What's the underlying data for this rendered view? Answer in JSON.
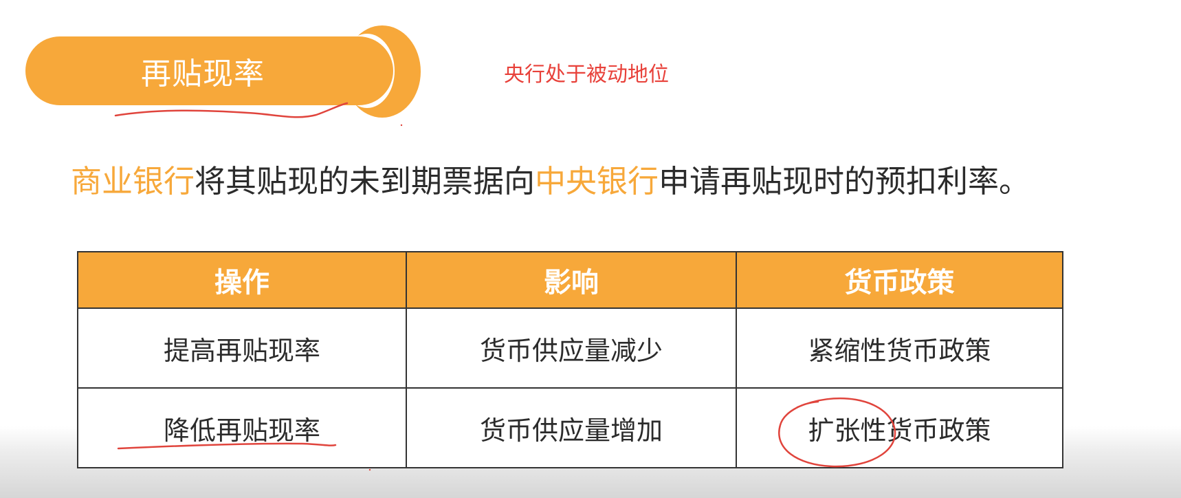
{
  "title": "再贴现率",
  "note": "央行处于被动地位",
  "definition": {
    "part1": "商业银行",
    "part2": "将其贴现的未到期票据向",
    "part3": "中央银行",
    "part4": "申请再贴现时的预扣利率。"
  },
  "table": {
    "headers": [
      "操作",
      "影响",
      "货币政策"
    ],
    "rows": [
      [
        "提高再贴现率",
        "货币供应量减少",
        "紧缩性货币政策"
      ],
      [
        "降低再贴现率",
        "货币供应量增加",
        "扩张性货币政策"
      ]
    ]
  },
  "colors": {
    "accent": "#f7a83a",
    "note": "#e8413a",
    "annotation_ink": "#e0443c",
    "text": "#2b2b2b"
  }
}
